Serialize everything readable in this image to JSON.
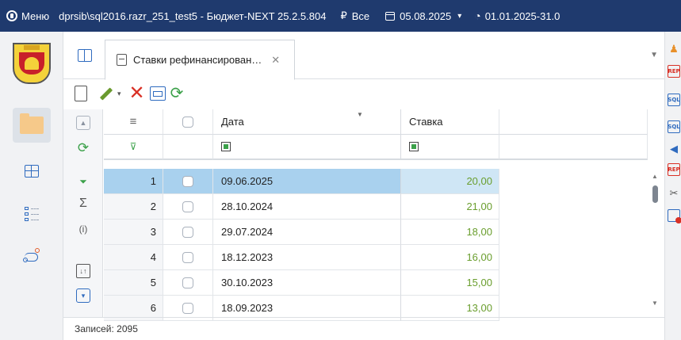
{
  "titlebar": {
    "menu_label": "Меню",
    "connection": "dprsib\\sql2016.razr_251_test5 - Бюджет-NEXT 25.2.5.804",
    "currency_symbol": "₽",
    "scope_label": "Все",
    "date": "05.08.2025",
    "period": "01.01.2025-31.0"
  },
  "tab": {
    "title": "Ставки рефинансирован…",
    "close": "✕"
  },
  "toolbar": {
    "delete_glyph": "✕",
    "refresh_glyph": "⟳",
    "dropdown_glyph": "▾"
  },
  "grid": {
    "columns": {
      "menu_glyph": "≡",
      "date": "Дата",
      "rate": "Ставка"
    },
    "rows": [
      {
        "num": "1",
        "date": "09.06.2025",
        "rate": "20,00",
        "selected": true
      },
      {
        "num": "2",
        "date": "28.10.2024",
        "rate": "21,00",
        "selected": false
      },
      {
        "num": "3",
        "date": "29.07.2024",
        "rate": "18,00",
        "selected": false
      },
      {
        "num": "4",
        "date": "18.12.2023",
        "rate": "16,00",
        "selected": false
      },
      {
        "num": "5",
        "date": "30.10.2023",
        "rate": "15,00",
        "selected": false
      },
      {
        "num": "6",
        "date": "18.09.2023",
        "rate": "13,00",
        "selected": false
      }
    ]
  },
  "grid_tools": {
    "sigma": "Σ",
    "info": "(i)",
    "refresh": "⟳",
    "funnel": "⏷",
    "sort": "↓↑"
  },
  "status": {
    "records": "Записей: 2095"
  },
  "right_tools": {
    "sql_label": "SQL",
    "rep_label": "REP"
  },
  "colors": {
    "titlebar_bg": "#1f3a6e",
    "selected_row": "#a9d1ee",
    "rate_value": "#6a9e2e",
    "accent_blue": "#2f6bbf",
    "refresh_green": "#3ca14a",
    "delete_red": "#d93025"
  }
}
